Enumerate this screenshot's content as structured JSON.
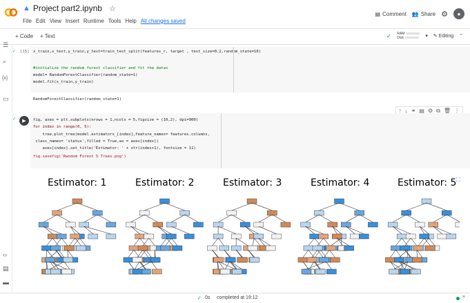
{
  "header": {
    "title": "Project part2.ipynb",
    "menu": [
      "File",
      "Edit",
      "View",
      "Insert",
      "Runtime",
      "Tools",
      "Help"
    ],
    "saved_status": "All changes saved",
    "comment_label": "Comment",
    "share_label": "Share"
  },
  "toolbar": {
    "code_label": "+ Code",
    "text_label": "+ Text",
    "ram_label": "RAM",
    "disk_label": "Disk",
    "editing_label": "Editing"
  },
  "cells": {
    "cell1": {
      "exec_count": "[15]",
      "line1": "x_train,x_test,y_train,y_test=train_test_split(features_r, target , test_size=0.2,random_state=10)",
      "comment": "#initialize the random forest classifier and fit the datas",
      "line3": "model= RandomForestClassifier(random_state=1)",
      "line4": "model.fit(x_train,y_train)",
      "output": "RandomForestClassifier(random_state=1)"
    },
    "cell2": {
      "line1": "fig, axes = plt.subplots(nrows = 1,ncols = 5,figsize = (10,2), dpi=900)",
      "line2": "for index in range(0, 5):",
      "line3": "    tree.plot_tree(model.estimators_[index],feature_names= features.columns,",
      "line4": " class_names= 'status',filled = True,ax = axes[index])",
      "line5": "    axes[index].set_title('Estimator: ' + str(index+1), fontsize = 11)",
      "line6": "fig.savefig('Random Forest 5 Trees.png')"
    }
  },
  "figure": {
    "titles": [
      "Estimator: 1",
      "Estimator: 2",
      "Estimator: 3",
      "Estimator: 4",
      "Estimator: 5"
    ]
  },
  "status": {
    "time": "0s",
    "completed": "completed at 19:12"
  },
  "colors": {
    "orange": "#e5813950",
    "blue": "#399de5"
  }
}
